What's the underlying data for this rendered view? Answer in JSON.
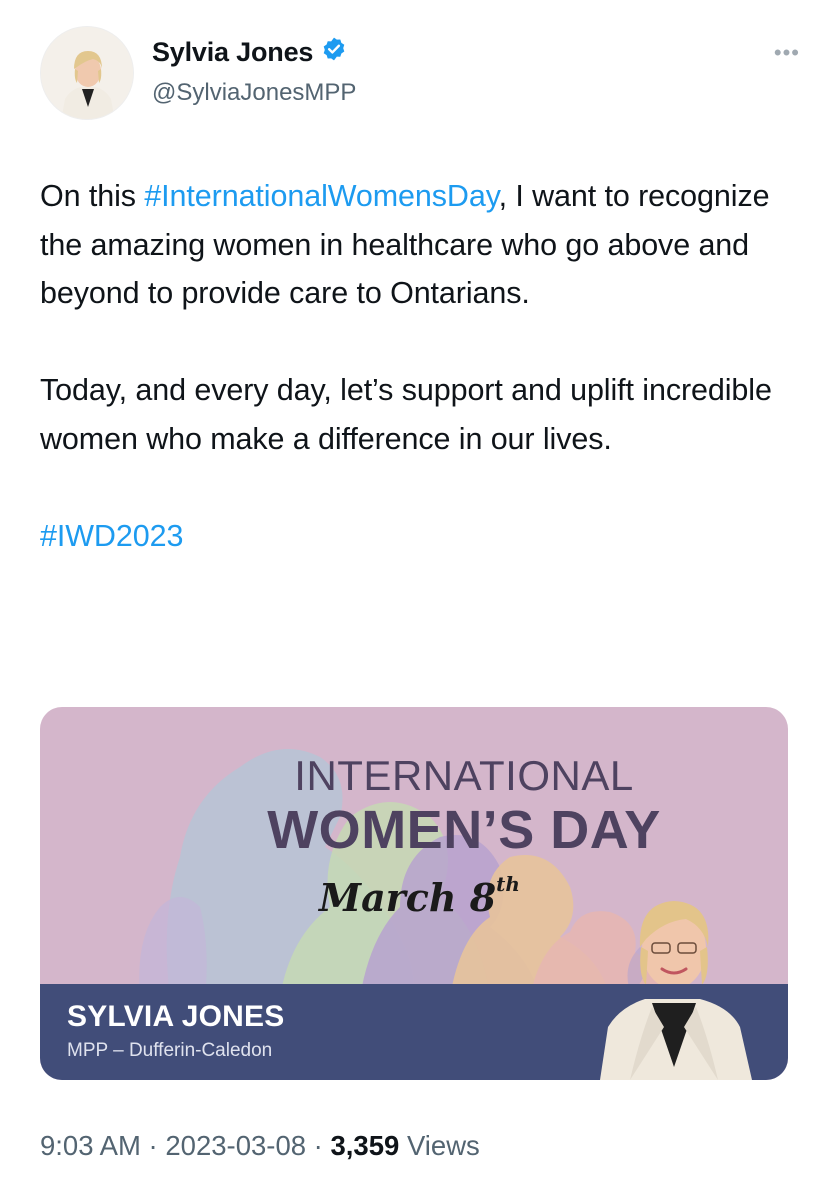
{
  "author": {
    "display_name": "Sylvia Jones",
    "handle": "@SylviaJonesMPP",
    "verified": true,
    "verified_color": "#1d9bf0"
  },
  "more_menu": "•••",
  "tweet": {
    "p1_before": "On this ",
    "p1_hashtag": "#InternationalWomensDay",
    "p1_after": ", I want to recognize the amazing women in healthcare who go above and beyond to provide care to Ontarians.",
    "p2": "Today, and every day, let’s support and uplift incredible women who make a difference in our lives.",
    "hashtag2": "#IWD2023",
    "link_color": "#1d9bf0"
  },
  "media": {
    "title_line1": "INTERNATIONAL",
    "title_line2": "WOMEN’S DAY",
    "date_main": "March 8",
    "date_suffix": "th",
    "banner_name": "SYLVIA JONES",
    "banner_subtitle": "MPP – Dufferin-Caledon",
    "background_color": "#d4b6cb",
    "banner_color": "#414d79"
  },
  "meta": {
    "time": "9:03 AM",
    "separator": "·",
    "date": "2023-03-08",
    "views_count": "3,359",
    "views_label": "Views"
  }
}
